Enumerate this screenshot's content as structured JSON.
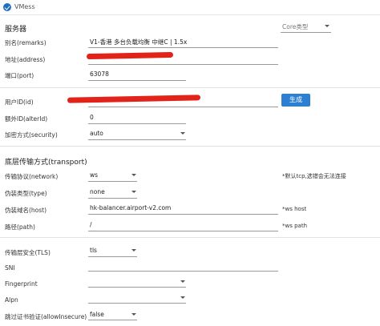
{
  "window": {
    "title": "VMess"
  },
  "server": {
    "section_title": "服务器",
    "core_type_placeholder": "Core类型",
    "remarks_label": "别名(remarks)",
    "remarks_value": "V1-香港 多台负载均衡 中继C | 1.5x",
    "address_label": "地址(address)",
    "port_label": "端口(port)",
    "port_value": "63078",
    "user_id_label": "用户ID(id)",
    "generate_button": "生成",
    "alter_id_label": "额外ID(alterId)",
    "alter_id_value": "0",
    "security_label": "加密方式(security)",
    "security_value": "auto"
  },
  "transport": {
    "section_title": "底层传输方式(transport)",
    "network_label": "传输协议(network)",
    "network_value": "ws",
    "network_note": "*默认tcp,选错会无法连接",
    "type_label": "伪装类型(type)",
    "type_value": "none",
    "host_label": "伪装域名(host)",
    "host_value": "hk-balancer.airport-v2.com",
    "host_note": "*ws host",
    "path_label": "路径(path)",
    "path_value": "/",
    "path_note": "*ws path"
  },
  "tls": {
    "tls_label": "传输层安全(TLS)",
    "tls_value": "tls",
    "sni_label": "SNI",
    "fingerprint_label": "Fingerprint",
    "alpn_label": "Alpn",
    "allow_insecure_label": "跳过证书验证(allowInsecure)",
    "allow_insecure_value": "false"
  },
  "colors": {
    "accent": "#2d7fd3",
    "redaction": "#e2231a"
  }
}
